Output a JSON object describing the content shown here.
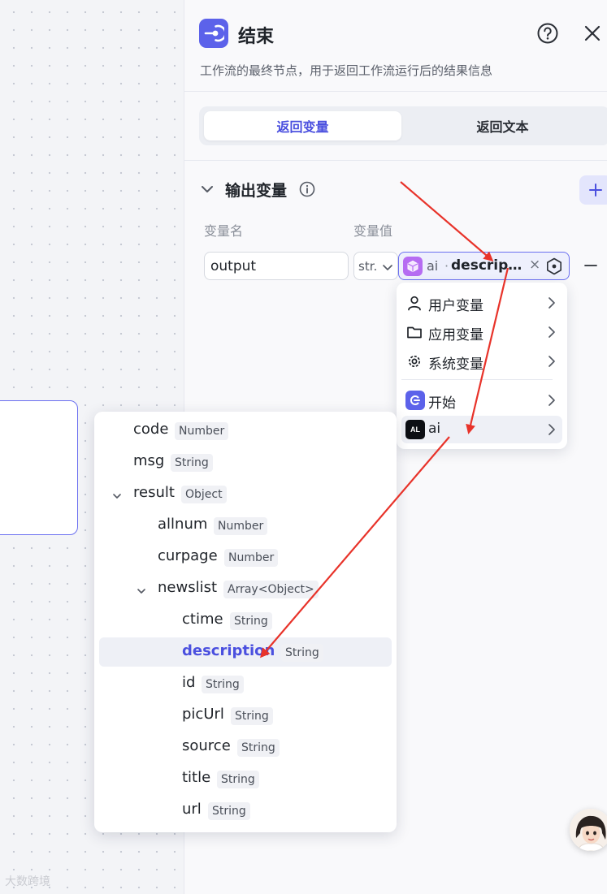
{
  "panel": {
    "title": "结束",
    "description": "工作流的最终节点，用于返回工作流运行后的结果信息",
    "tabs": [
      {
        "label": "返回变量",
        "active": true
      },
      {
        "label": "返回文本",
        "active": false
      }
    ],
    "section_title": "输出变量",
    "column_labels": {
      "name": "变量名",
      "value": "变量值"
    },
    "row": {
      "name_value": "output",
      "type": "str.",
      "ref_node": "ai",
      "ref_separator": "·",
      "ref_variable": "description",
      "ref_clear": "×"
    }
  },
  "source_menu": {
    "items": [
      {
        "label": "用户变量",
        "icon": "user-icon"
      },
      {
        "label": "应用变量",
        "icon": "folder-icon"
      },
      {
        "label": "系统变量",
        "icon": "gear-icon"
      },
      {
        "label": "开始",
        "icon": "start-node-icon"
      },
      {
        "label": "ai",
        "icon": "ai-node-icon",
        "active": true
      }
    ],
    "ai_icon_text": "AL"
  },
  "variable_tree": [
    {
      "name": "code",
      "type": "Number",
      "level": 0
    },
    {
      "name": "msg",
      "type": "String",
      "level": 0
    },
    {
      "name": "result",
      "type": "Object",
      "level": 0,
      "expanded": true
    },
    {
      "name": "allnum",
      "type": "Number",
      "level": 1
    },
    {
      "name": "curpage",
      "type": "Number",
      "level": 1
    },
    {
      "name": "newslist",
      "type": "Array<Object>",
      "level": 1,
      "expanded": true
    },
    {
      "name": "ctime",
      "type": "String",
      "level": 2
    },
    {
      "name": "description",
      "type": "String",
      "level": 2,
      "selected": true
    },
    {
      "name": "id",
      "type": "String",
      "level": 2
    },
    {
      "name": "picUrl",
      "type": "String",
      "level": 2
    },
    {
      "name": "source",
      "type": "String",
      "level": 2
    },
    {
      "name": "title",
      "type": "String",
      "level": 2
    },
    {
      "name": "url",
      "type": "String",
      "level": 2
    }
  ],
  "watermark": "大数跨境",
  "colors": {
    "accent": "#4b50df",
    "node_icon": "#5c62ea",
    "annotation": "#e8332a"
  }
}
